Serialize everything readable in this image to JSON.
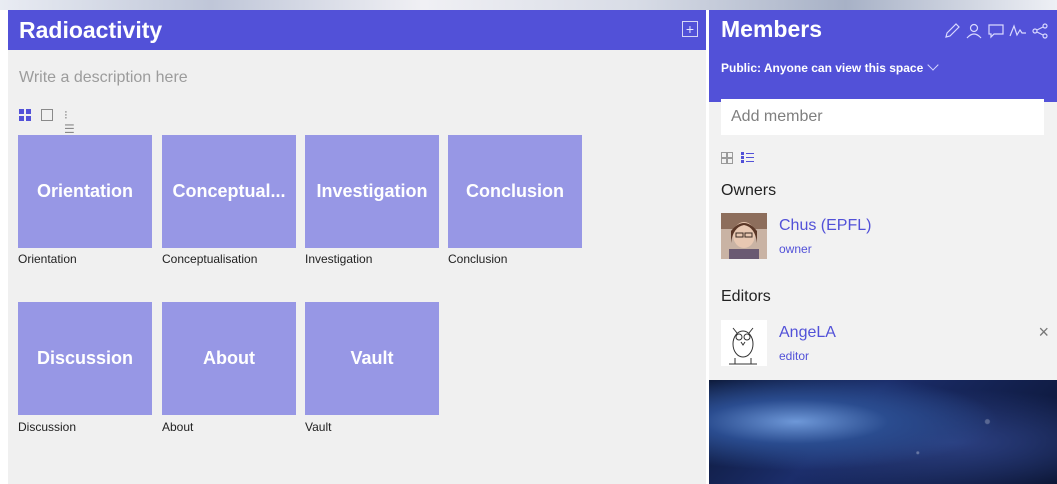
{
  "left": {
    "title": "Radioactivity",
    "add_icon": "plus-square-icon",
    "description_placeholder": "Write a description here",
    "tiles": [
      {
        "label": "Orientation",
        "caption": "Orientation"
      },
      {
        "label": "Conceptual...",
        "caption": "Conceptualisation"
      },
      {
        "label": "Investigation",
        "caption": "Investigation"
      },
      {
        "label": "Conclusion",
        "caption": "Conclusion"
      },
      {
        "label": "Discussion",
        "caption": "Discussion"
      },
      {
        "label": "About",
        "caption": "About"
      },
      {
        "label": "Vault",
        "caption": "Vault"
      }
    ]
  },
  "right": {
    "title": "Members",
    "icons": [
      "pencil-icon",
      "user-icon",
      "chat-icon",
      "activity-icon",
      "share-icon"
    ],
    "visibility": "Public: Anyone can view this space",
    "add_member_placeholder": "Add member",
    "owners_label": "Owners",
    "editors_label": "Editors",
    "owners": [
      {
        "name": "Chus (EPFL)",
        "role": "owner"
      }
    ],
    "editors": [
      {
        "name": "AngeLA",
        "role": "editor"
      }
    ],
    "remove_glyph": "×"
  },
  "colors": {
    "accent": "#5251d8",
    "tile": "#9797e5",
    "panel": "#f0f0f0"
  }
}
